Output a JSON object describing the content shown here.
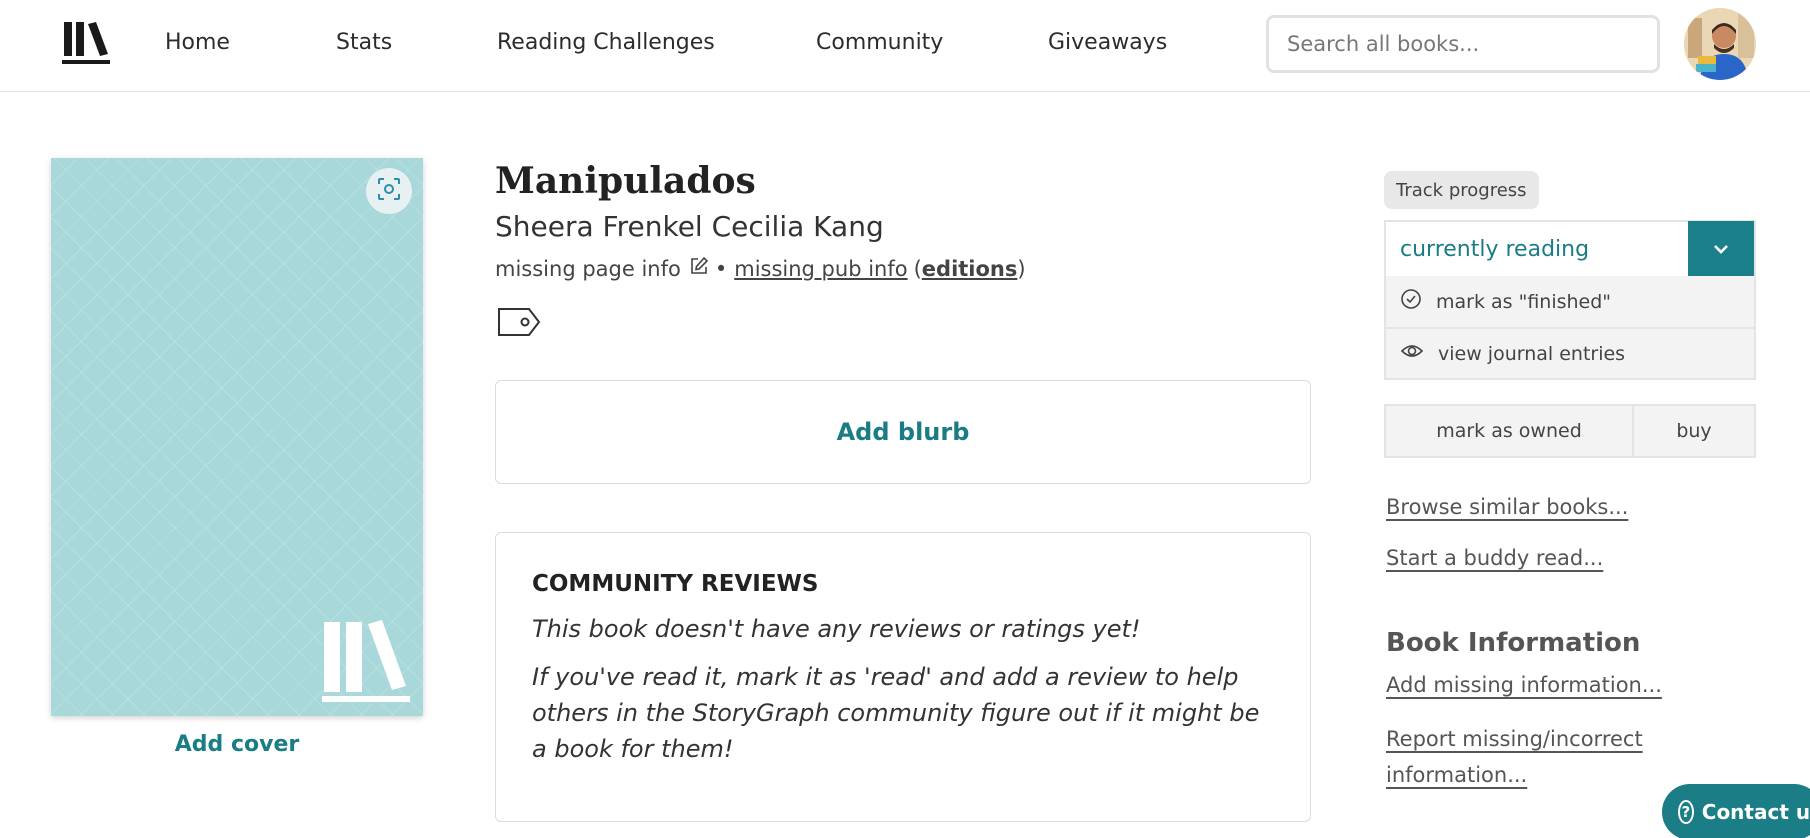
{
  "header": {
    "nav": [
      "Home",
      "Stats",
      "Reading Challenges",
      "Community",
      "Giveaways"
    ],
    "search_placeholder": "Search all books..."
  },
  "cover": {
    "add_cover_label": "Add cover",
    "color": "#a8d8d9"
  },
  "book": {
    "title": "Manipulados",
    "authors": "Sheera Frenkel Cecilia Kang",
    "page_info": "missing page info",
    "separator": "•",
    "pub_info": "missing pub info",
    "editions_open": "(",
    "editions": "editions",
    "editions_close": ")"
  },
  "blurb": {
    "label": "Add blurb"
  },
  "reviews": {
    "heading": "COMMUNITY REVIEWS",
    "line1": "This book doesn't have any reviews or ratings yet!",
    "line2": "If you've read it, mark it as 'read' and add a review to help others in the StoryGraph community figure out if it might be a book for them!"
  },
  "tracking": {
    "label": "Track progress",
    "status": "currently reading",
    "menu": [
      "mark as \"finished\"",
      "view journal entries"
    ],
    "owned_label": "mark as owned",
    "buy_label": "buy"
  },
  "sidebar": {
    "browse_similar": "Browse similar books...",
    "buddy_read": "Start a buddy read...",
    "book_info_heading": "Book Information",
    "add_missing": "Add missing information...",
    "report_line1": "Report missing/incorrect",
    "report_line2": "information..."
  },
  "contact": {
    "label": "Contact us"
  },
  "colors": {
    "accent": "#1a7c84",
    "accent_dark": "#1b8089",
    "cover": "#a8d8d9"
  },
  "icons": [
    "storygraph-logo-icon",
    "scan-icon",
    "edit-icon",
    "tag-icon",
    "chevron-down-icon",
    "check-circle-icon",
    "eye-icon",
    "question-circle-icon"
  ]
}
